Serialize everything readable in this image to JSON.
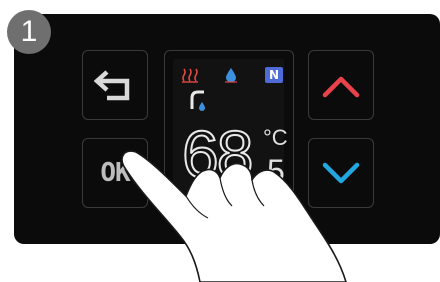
{
  "step": {
    "number": "1"
  },
  "buttons": {
    "back": {
      "icon": "back-arrow-icon",
      "color": "#d9d9d9"
    },
    "ok": {
      "label": "OK"
    },
    "up": {
      "icon": "chevron-up-icon",
      "color": "#e8424c"
    },
    "down": {
      "icon": "chevron-down-icon",
      "color": "#23a7e1"
    }
  },
  "display": {
    "heat_icon": "heating-icon",
    "drop_icon": "water-drop-icon",
    "mode_badge": "N",
    "tap_icon": "faucet-icon",
    "temperature": "68",
    "unit": "°C",
    "decimal": "5"
  },
  "colors": {
    "heat": "#e24b44",
    "drop": "#3d8fe0",
    "mode": "#4f6bd8",
    "panel": "#0b0b0b"
  }
}
